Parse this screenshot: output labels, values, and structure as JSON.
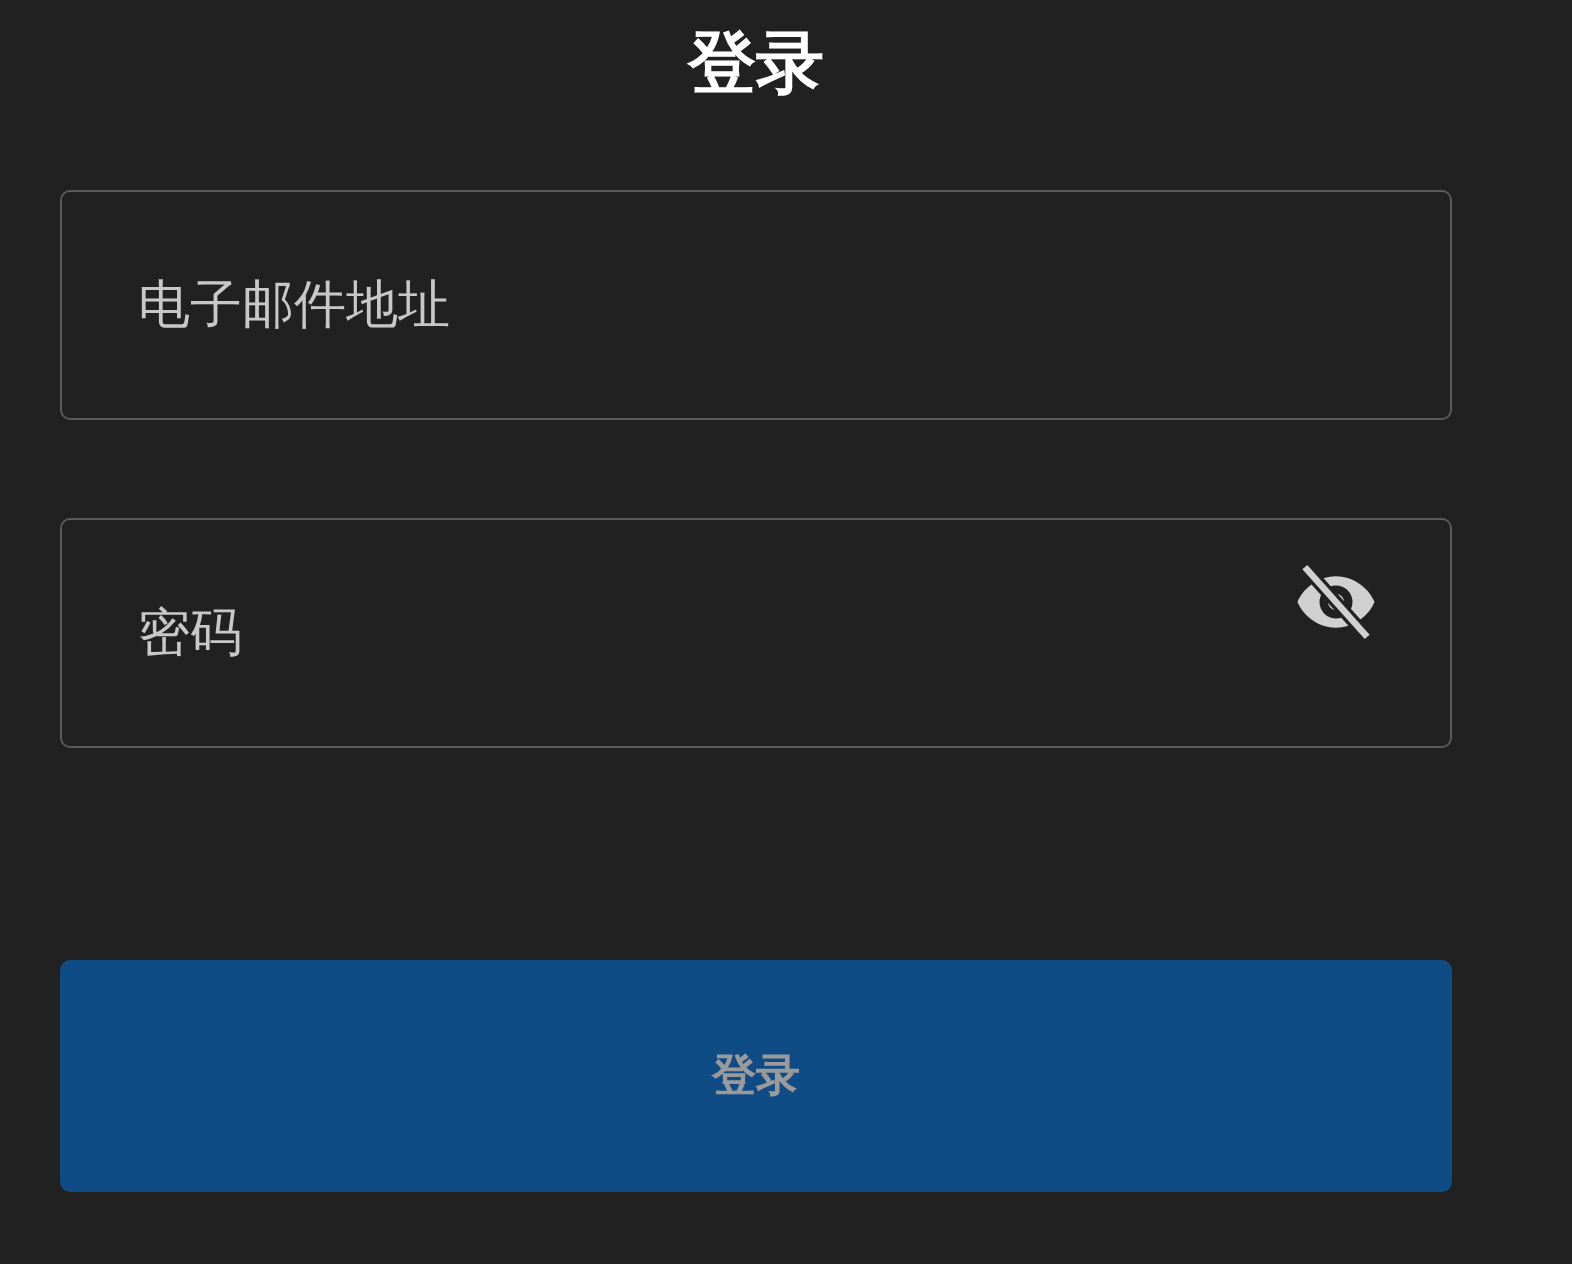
{
  "title": "登录",
  "email_field": {
    "placeholder": "电子邮件地址"
  },
  "password_field": {
    "placeholder": "密码",
    "password_visible": false
  },
  "login_button": {
    "label": "登录",
    "disabled": true
  }
}
